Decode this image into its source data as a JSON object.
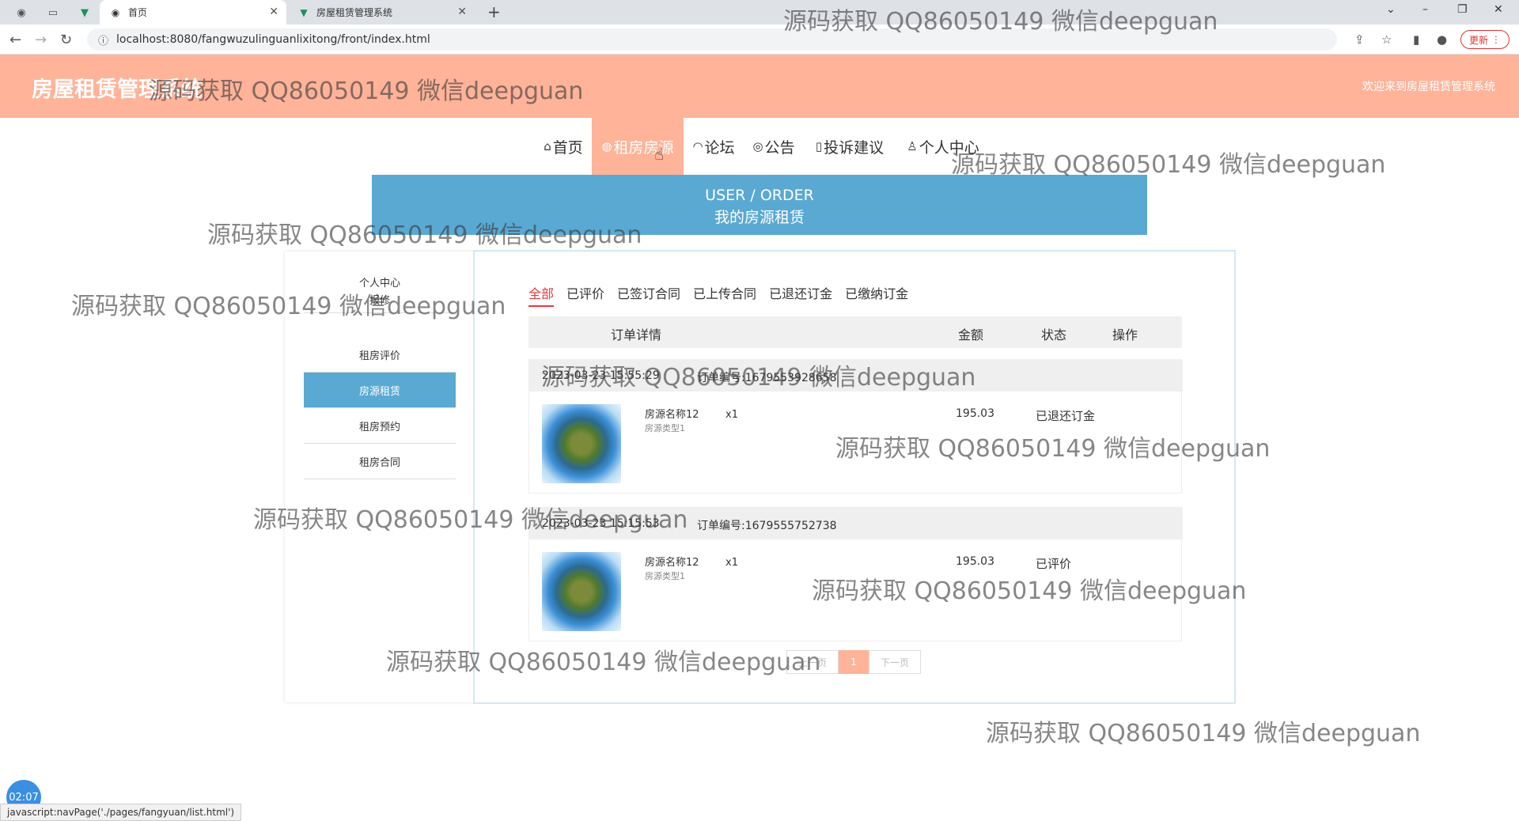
{
  "browser": {
    "tabs": [
      {
        "label": "首页",
        "active": true
      },
      {
        "label": "房屋租赁管理系统",
        "active": false
      }
    ],
    "url": "localhost:8080/fangwuzulinguanlixitong/front/index.html",
    "update_label": "更新"
  },
  "header": {
    "site_title": "房屋租赁管理系统",
    "welcome": "欢迎来到房屋租赁管理系统"
  },
  "nav": {
    "items": [
      {
        "label": "首页",
        "icon": "home-icon"
      },
      {
        "label": "租房房源",
        "icon": "globe-icon",
        "active": true
      },
      {
        "label": "论坛",
        "icon": "chat-icon"
      },
      {
        "label": "公告",
        "icon": "announce-icon"
      },
      {
        "label": "投诉建议",
        "icon": "feedback-icon"
      },
      {
        "label": "个人中心",
        "icon": "user-icon"
      }
    ]
  },
  "banner": {
    "en": "USER / ORDER",
    "cn": "我的房源租赁"
  },
  "sidebar": {
    "items": [
      {
        "label": "个人中心"
      },
      {
        "label": "报修"
      },
      {
        "label": "租房评价"
      },
      {
        "label": "房源租赁",
        "active": true
      },
      {
        "label": "租房预约"
      },
      {
        "label": "租房合同"
      }
    ]
  },
  "main": {
    "tabs": [
      "全部",
      "已评价",
      "已签订合同",
      "已上传合同",
      "已退还订金",
      "已缴纳订金"
    ],
    "columns": [
      "订单详情",
      "金额",
      "状态",
      "操作"
    ],
    "orders": [
      {
        "time": "2023-03-23 15:55:29",
        "order_no": "订单编号:1679553928658",
        "name": "房源名称12",
        "type": "房源类型1",
        "qty": "x1",
        "amount": "195.03",
        "status": "已退还订金"
      },
      {
        "time": "2023-03-23 15:15:53",
        "order_no": "订单编号:1679555752738",
        "name": "房源名称12",
        "type": "房源类型1",
        "qty": "x1",
        "amount": "195.03",
        "status": "已评价"
      }
    ],
    "pager": {
      "prev": "上一页",
      "current": "1",
      "next": "下一页"
    }
  },
  "watermark": "源码获取 QQ86050149 微信deepguan",
  "statusbar": "javascript:navPage('./pages/fangyuan/list.html')",
  "timer": "02:07"
}
